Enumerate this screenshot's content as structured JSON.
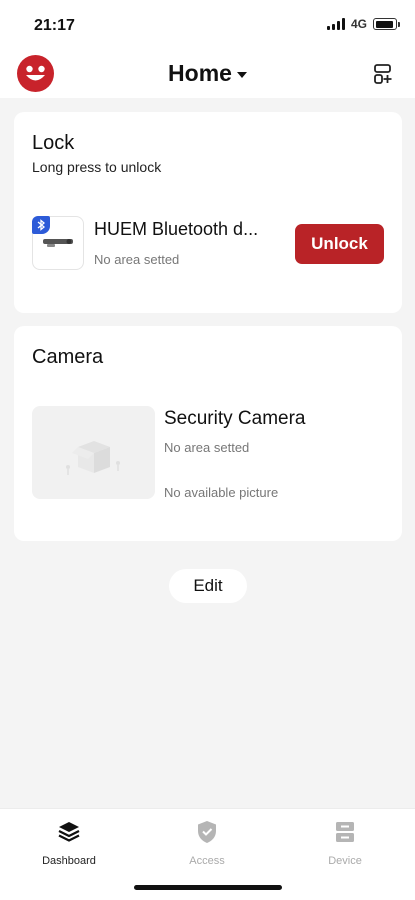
{
  "status_bar": {
    "time": "21:17",
    "network": "4G",
    "battery_level": 0.9
  },
  "header": {
    "title": "Home",
    "avatar_icon": "smiley-face-icon",
    "layout_icon": "layout-add-icon"
  },
  "lock_card": {
    "title": "Lock",
    "subtitle": "Long press to unlock",
    "device": {
      "name": "HUEM Bluetooth d...",
      "area": "No area setted",
      "badge_icon": "bluetooth-icon"
    },
    "unlock_label": "Unlock"
  },
  "camera_card": {
    "title": "Camera",
    "device": {
      "name": "Security Camera",
      "area": "No area setted",
      "picture_status": "No available picture"
    }
  },
  "edit_label": "Edit",
  "bottom_nav": [
    {
      "label": "Dashboard",
      "icon": "layers-icon",
      "active": true
    },
    {
      "label": "Access",
      "icon": "shield-check-icon",
      "active": false
    },
    {
      "label": "Device",
      "icon": "device-icon",
      "active": false
    }
  ],
  "colors": {
    "accent": "#b92327",
    "avatar": "#c8232b",
    "badge": "#2d5bd8",
    "background": "#f4f4f4"
  }
}
